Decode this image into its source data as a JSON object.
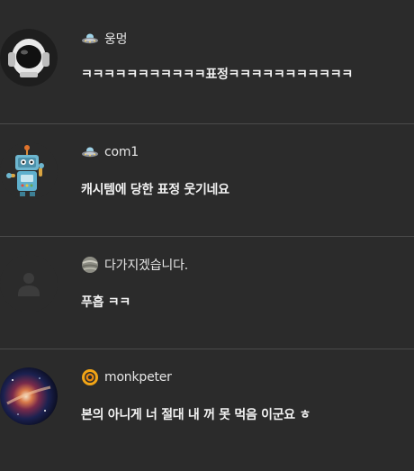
{
  "comments": [
    {
      "nickname": "웅멍",
      "text": "ㅋㅋㅋㅋㅋㅋㅋㅋㅋㅋㅋ표정ㅋㅋㅋㅋㅋㅋㅋㅋㅋㅋㅋ",
      "avatar_icon": "astronaut-helmet-icon",
      "level_icon": "ufo-icon"
    },
    {
      "nickname": "com1",
      "text": "캐시템에 당한 표정 웃기네요",
      "avatar_icon": "robot-icon",
      "level_icon": "ufo-icon"
    },
    {
      "nickname": "다가지겠습니다.",
      "text": "푸흡 ㅋㅋ",
      "avatar_icon": "default-user-icon",
      "level_icon": "planet-icon"
    },
    {
      "nickname": "monkpeter",
      "text": "본의 아니게 너 절대 내 꺼 못 먹음 이군요 ㅎ",
      "avatar_icon": "galaxy-icon",
      "level_icon": "spiral-icon"
    }
  ],
  "colors": {
    "background": "#2b2b2b",
    "divider": "#4a4a4a",
    "text": "#f2f2f2"
  }
}
